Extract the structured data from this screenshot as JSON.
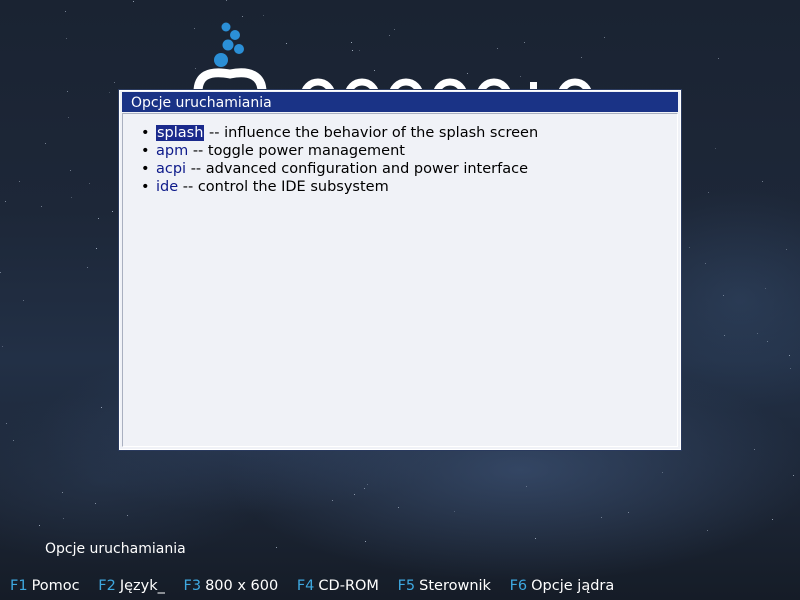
{
  "dialog": {
    "title": "Opcje uruchamiania",
    "options": [
      {
        "name": "splash",
        "description": "-- influence the behavior of the splash screen",
        "selected": true
      },
      {
        "name": "apm",
        "description": "-- toggle power management",
        "selected": false
      },
      {
        "name": "acpi",
        "description": "-- advanced configuration and power interface",
        "selected": false
      },
      {
        "name": "ide",
        "description": "-- control the IDE subsystem",
        "selected": false
      }
    ]
  },
  "boot_options_label": "Opcje uruchamiania",
  "function_keys": [
    {
      "key": "F1",
      "label": "Pomoc"
    },
    {
      "key": "F2",
      "label": "Język_"
    },
    {
      "key": "F3",
      "label": "800 x 600"
    },
    {
      "key": "F4",
      "label": "CD-ROM"
    },
    {
      "key": "F5",
      "label": "Sterownik"
    },
    {
      "key": "F6",
      "label": "Opcje jądra"
    }
  ],
  "colors": {
    "title_bar": "#1a3386",
    "selection": "#1a2a8c",
    "function_key": "#3ea8e0",
    "logo_accent": "#2b8fd6"
  },
  "icons": {
    "logo": "opensuse-logo"
  }
}
